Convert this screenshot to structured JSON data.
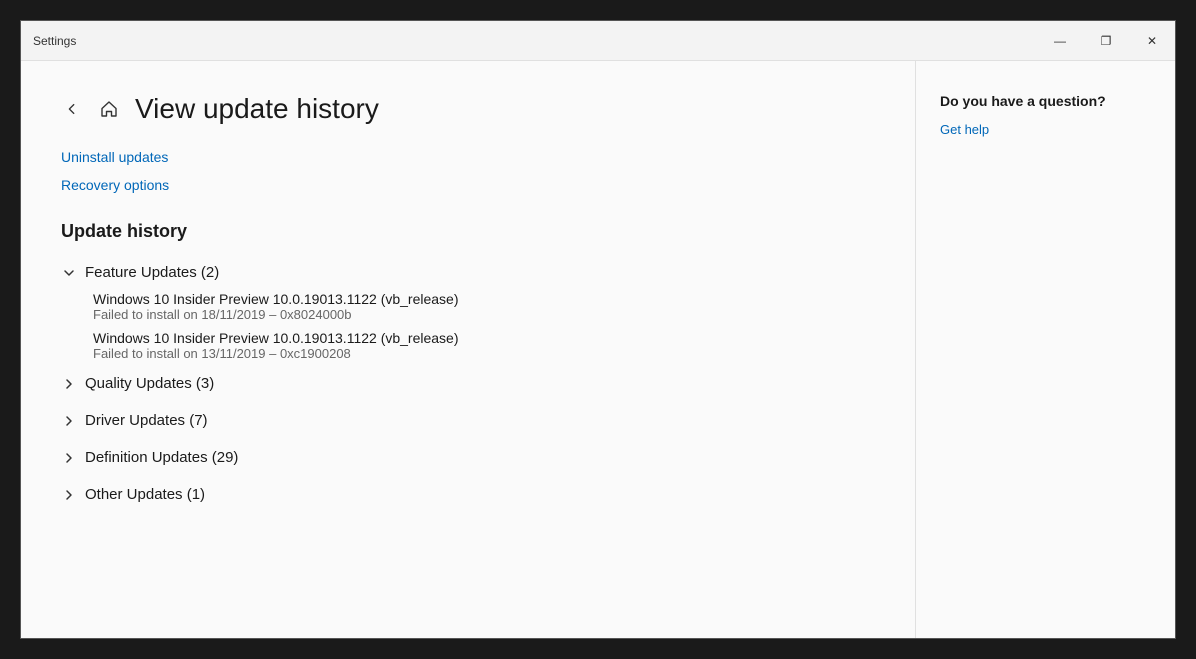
{
  "titlebar": {
    "title": "Settings",
    "minimize_label": "—",
    "maximize_label": "❐",
    "close_label": "✕"
  },
  "header": {
    "back_label": "←",
    "page_title": "View update history"
  },
  "links": {
    "uninstall_label": "Uninstall updates",
    "recovery_label": "Recovery options"
  },
  "update_history": {
    "section_title": "Update history",
    "categories": [
      {
        "id": "feature",
        "label": "Feature Updates (2)",
        "expanded": true,
        "chevron": "down",
        "items": [
          {
            "name": "Windows 10 Insider Preview 10.0.19013.1122 (vb_release)",
            "status": "Failed to install on 18/11/2019 – 0x8024000b"
          },
          {
            "name": "Windows 10 Insider Preview 10.0.19013.1122 (vb_release)",
            "status": "Failed to install on 13/11/2019 – 0xc1900208"
          }
        ]
      },
      {
        "id": "quality",
        "label": "Quality Updates (3)",
        "expanded": false,
        "chevron": "right",
        "items": []
      },
      {
        "id": "driver",
        "label": "Driver Updates (7)",
        "expanded": false,
        "chevron": "right",
        "items": []
      },
      {
        "id": "definition",
        "label": "Definition Updates (29)",
        "expanded": false,
        "chevron": "right",
        "items": []
      },
      {
        "id": "other",
        "label": "Other Updates (1)",
        "expanded": false,
        "chevron": "right",
        "items": []
      }
    ]
  },
  "sidebar": {
    "help_title": "Do you have a question?",
    "get_help_label": "Get help"
  }
}
